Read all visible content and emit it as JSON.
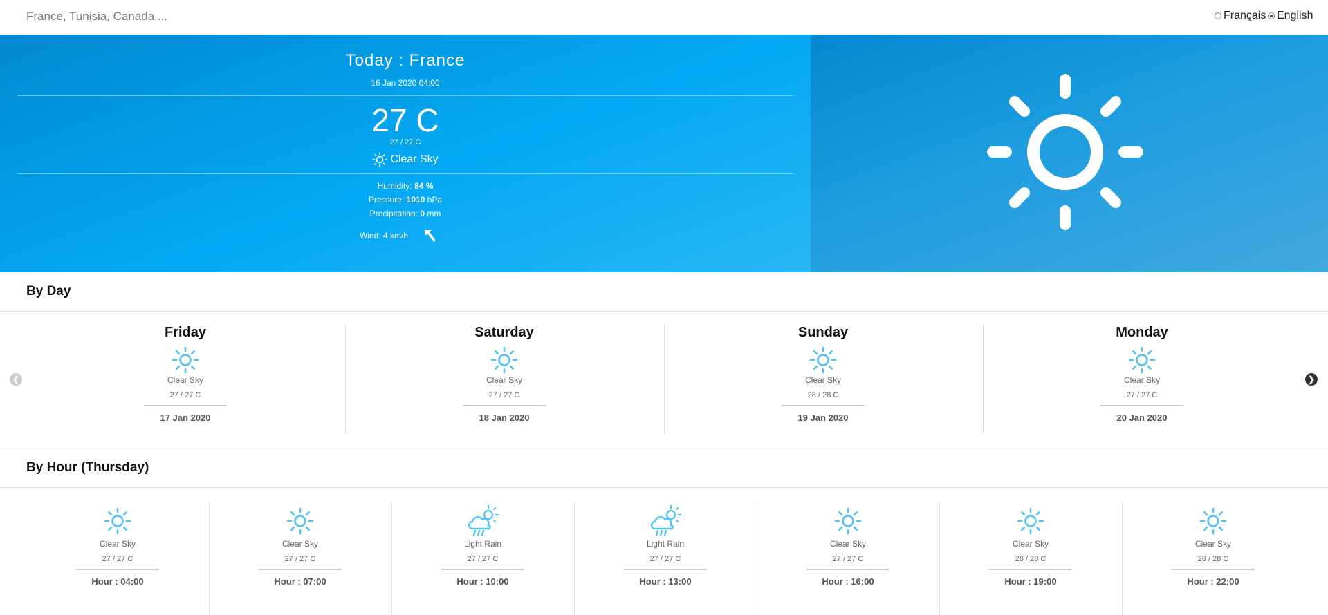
{
  "search": {
    "placeholder": "France, Tunisia, Canada ..."
  },
  "language": {
    "options": [
      "Français",
      "English"
    ],
    "selected": "English"
  },
  "today": {
    "title": "Today : France",
    "datetime": "16 Jan 2020 04:00",
    "temperature": "27 C",
    "minmax": "27 / 27 C",
    "condition": "Clear Sky",
    "condition_icon": "sun-icon",
    "humidity_label": "Humidity:",
    "humidity_value": "84",
    "humidity_unit": "%",
    "pressure_label": "Pressure:",
    "pressure_value": "1010",
    "pressure_unit": "hPa",
    "precip_label": "Precipitation:",
    "precip_value": "0",
    "precip_unit": "mm",
    "wind": "Wind: 4 km/h",
    "wind_icon": "wind-direction-arrow-icon"
  },
  "by_day": {
    "title": "By Day",
    "days": [
      {
        "name": "Friday",
        "icon": "sun-icon",
        "condition": "Clear Sky",
        "minmax": "27 / 27 C",
        "date": "17 Jan 2020"
      },
      {
        "name": "Saturday",
        "icon": "sun-icon",
        "condition": "Clear Sky",
        "minmax": "27 / 27 C",
        "date": "18 Jan 2020"
      },
      {
        "name": "Sunday",
        "icon": "sun-icon",
        "condition": "Clear Sky",
        "minmax": "28 / 28 C",
        "date": "19 Jan 2020"
      },
      {
        "name": "Monday",
        "icon": "sun-icon",
        "condition": "Clear Sky",
        "minmax": "27 / 27 C",
        "date": "20 Jan 2020"
      }
    ]
  },
  "by_hour": {
    "title": "By Hour (Thursday)",
    "hours": [
      {
        "icon": "sun-icon",
        "condition": "Clear Sky",
        "minmax": "27 / 27 C",
        "hour": "Hour : 04:00"
      },
      {
        "icon": "sun-icon",
        "condition": "Clear Sky",
        "minmax": "27 / 27 C",
        "hour": "Hour : 07:00"
      },
      {
        "icon": "rain-cloud-sun-icon",
        "condition": "Light Rain",
        "minmax": "27 / 27 C",
        "hour": "Hour : 10:00"
      },
      {
        "icon": "rain-cloud-sun-icon",
        "condition": "Light Rain",
        "minmax": "27 / 27 C",
        "hour": "Hour : 13:00"
      },
      {
        "icon": "sun-icon",
        "condition": "Clear Sky",
        "minmax": "27 / 27 C",
        "hour": "Hour : 16:00"
      },
      {
        "icon": "sun-icon",
        "condition": "Clear Sky",
        "minmax": "28 / 28 C",
        "hour": "Hour : 19:00"
      },
      {
        "icon": "sun-icon",
        "condition": "Clear Sky",
        "minmax": "28 / 28 C",
        "hour": "Hour : 22:00"
      }
    ]
  },
  "colors": {
    "hero_blue": "#03a9f4",
    "icon_blue": "#4fc3f7"
  }
}
